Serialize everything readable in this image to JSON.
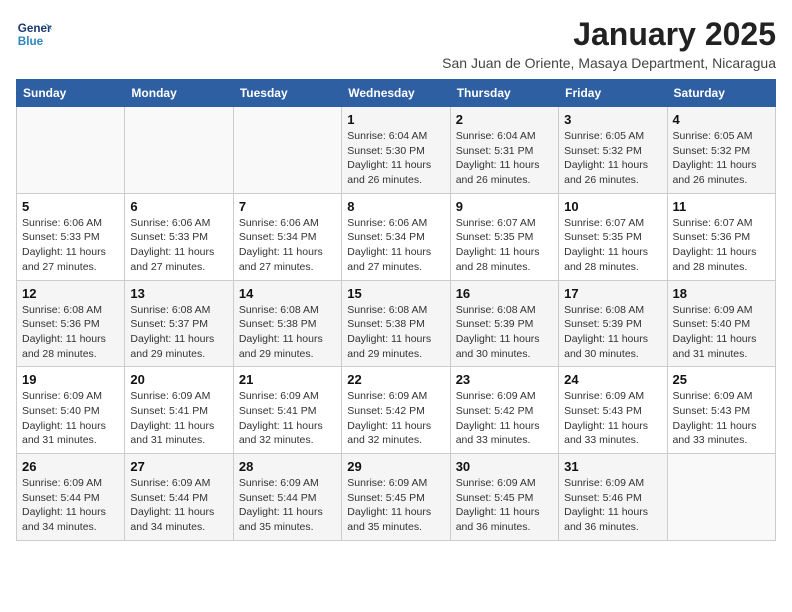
{
  "header": {
    "logo_line1": "General",
    "logo_line2": "Blue",
    "title": "January 2025",
    "subtitle": "San Juan de Oriente, Masaya Department, Nicaragua"
  },
  "weekdays": [
    "Sunday",
    "Monday",
    "Tuesday",
    "Wednesday",
    "Thursday",
    "Friday",
    "Saturday"
  ],
  "weeks": [
    [
      {
        "day": "",
        "info": ""
      },
      {
        "day": "",
        "info": ""
      },
      {
        "day": "",
        "info": ""
      },
      {
        "day": "1",
        "info": "Sunrise: 6:04 AM\nSunset: 5:30 PM\nDaylight: 11 hours and 26 minutes."
      },
      {
        "day": "2",
        "info": "Sunrise: 6:04 AM\nSunset: 5:31 PM\nDaylight: 11 hours and 26 minutes."
      },
      {
        "day": "3",
        "info": "Sunrise: 6:05 AM\nSunset: 5:32 PM\nDaylight: 11 hours and 26 minutes."
      },
      {
        "day": "4",
        "info": "Sunrise: 6:05 AM\nSunset: 5:32 PM\nDaylight: 11 hours and 26 minutes."
      }
    ],
    [
      {
        "day": "5",
        "info": "Sunrise: 6:06 AM\nSunset: 5:33 PM\nDaylight: 11 hours and 27 minutes."
      },
      {
        "day": "6",
        "info": "Sunrise: 6:06 AM\nSunset: 5:33 PM\nDaylight: 11 hours and 27 minutes."
      },
      {
        "day": "7",
        "info": "Sunrise: 6:06 AM\nSunset: 5:34 PM\nDaylight: 11 hours and 27 minutes."
      },
      {
        "day": "8",
        "info": "Sunrise: 6:06 AM\nSunset: 5:34 PM\nDaylight: 11 hours and 27 minutes."
      },
      {
        "day": "9",
        "info": "Sunrise: 6:07 AM\nSunset: 5:35 PM\nDaylight: 11 hours and 28 minutes."
      },
      {
        "day": "10",
        "info": "Sunrise: 6:07 AM\nSunset: 5:35 PM\nDaylight: 11 hours and 28 minutes."
      },
      {
        "day": "11",
        "info": "Sunrise: 6:07 AM\nSunset: 5:36 PM\nDaylight: 11 hours and 28 minutes."
      }
    ],
    [
      {
        "day": "12",
        "info": "Sunrise: 6:08 AM\nSunset: 5:36 PM\nDaylight: 11 hours and 28 minutes."
      },
      {
        "day": "13",
        "info": "Sunrise: 6:08 AM\nSunset: 5:37 PM\nDaylight: 11 hours and 29 minutes."
      },
      {
        "day": "14",
        "info": "Sunrise: 6:08 AM\nSunset: 5:38 PM\nDaylight: 11 hours and 29 minutes."
      },
      {
        "day": "15",
        "info": "Sunrise: 6:08 AM\nSunset: 5:38 PM\nDaylight: 11 hours and 29 minutes."
      },
      {
        "day": "16",
        "info": "Sunrise: 6:08 AM\nSunset: 5:39 PM\nDaylight: 11 hours and 30 minutes."
      },
      {
        "day": "17",
        "info": "Sunrise: 6:08 AM\nSunset: 5:39 PM\nDaylight: 11 hours and 30 minutes."
      },
      {
        "day": "18",
        "info": "Sunrise: 6:09 AM\nSunset: 5:40 PM\nDaylight: 11 hours and 31 minutes."
      }
    ],
    [
      {
        "day": "19",
        "info": "Sunrise: 6:09 AM\nSunset: 5:40 PM\nDaylight: 11 hours and 31 minutes."
      },
      {
        "day": "20",
        "info": "Sunrise: 6:09 AM\nSunset: 5:41 PM\nDaylight: 11 hours and 31 minutes."
      },
      {
        "day": "21",
        "info": "Sunrise: 6:09 AM\nSunset: 5:41 PM\nDaylight: 11 hours and 32 minutes."
      },
      {
        "day": "22",
        "info": "Sunrise: 6:09 AM\nSunset: 5:42 PM\nDaylight: 11 hours and 32 minutes."
      },
      {
        "day": "23",
        "info": "Sunrise: 6:09 AM\nSunset: 5:42 PM\nDaylight: 11 hours and 33 minutes."
      },
      {
        "day": "24",
        "info": "Sunrise: 6:09 AM\nSunset: 5:43 PM\nDaylight: 11 hours and 33 minutes."
      },
      {
        "day": "25",
        "info": "Sunrise: 6:09 AM\nSunset: 5:43 PM\nDaylight: 11 hours and 33 minutes."
      }
    ],
    [
      {
        "day": "26",
        "info": "Sunrise: 6:09 AM\nSunset: 5:44 PM\nDaylight: 11 hours and 34 minutes."
      },
      {
        "day": "27",
        "info": "Sunrise: 6:09 AM\nSunset: 5:44 PM\nDaylight: 11 hours and 34 minutes."
      },
      {
        "day": "28",
        "info": "Sunrise: 6:09 AM\nSunset: 5:44 PM\nDaylight: 11 hours and 35 minutes."
      },
      {
        "day": "29",
        "info": "Sunrise: 6:09 AM\nSunset: 5:45 PM\nDaylight: 11 hours and 35 minutes."
      },
      {
        "day": "30",
        "info": "Sunrise: 6:09 AM\nSunset: 5:45 PM\nDaylight: 11 hours and 36 minutes."
      },
      {
        "day": "31",
        "info": "Sunrise: 6:09 AM\nSunset: 5:46 PM\nDaylight: 11 hours and 36 minutes."
      },
      {
        "day": "",
        "info": ""
      }
    ]
  ]
}
